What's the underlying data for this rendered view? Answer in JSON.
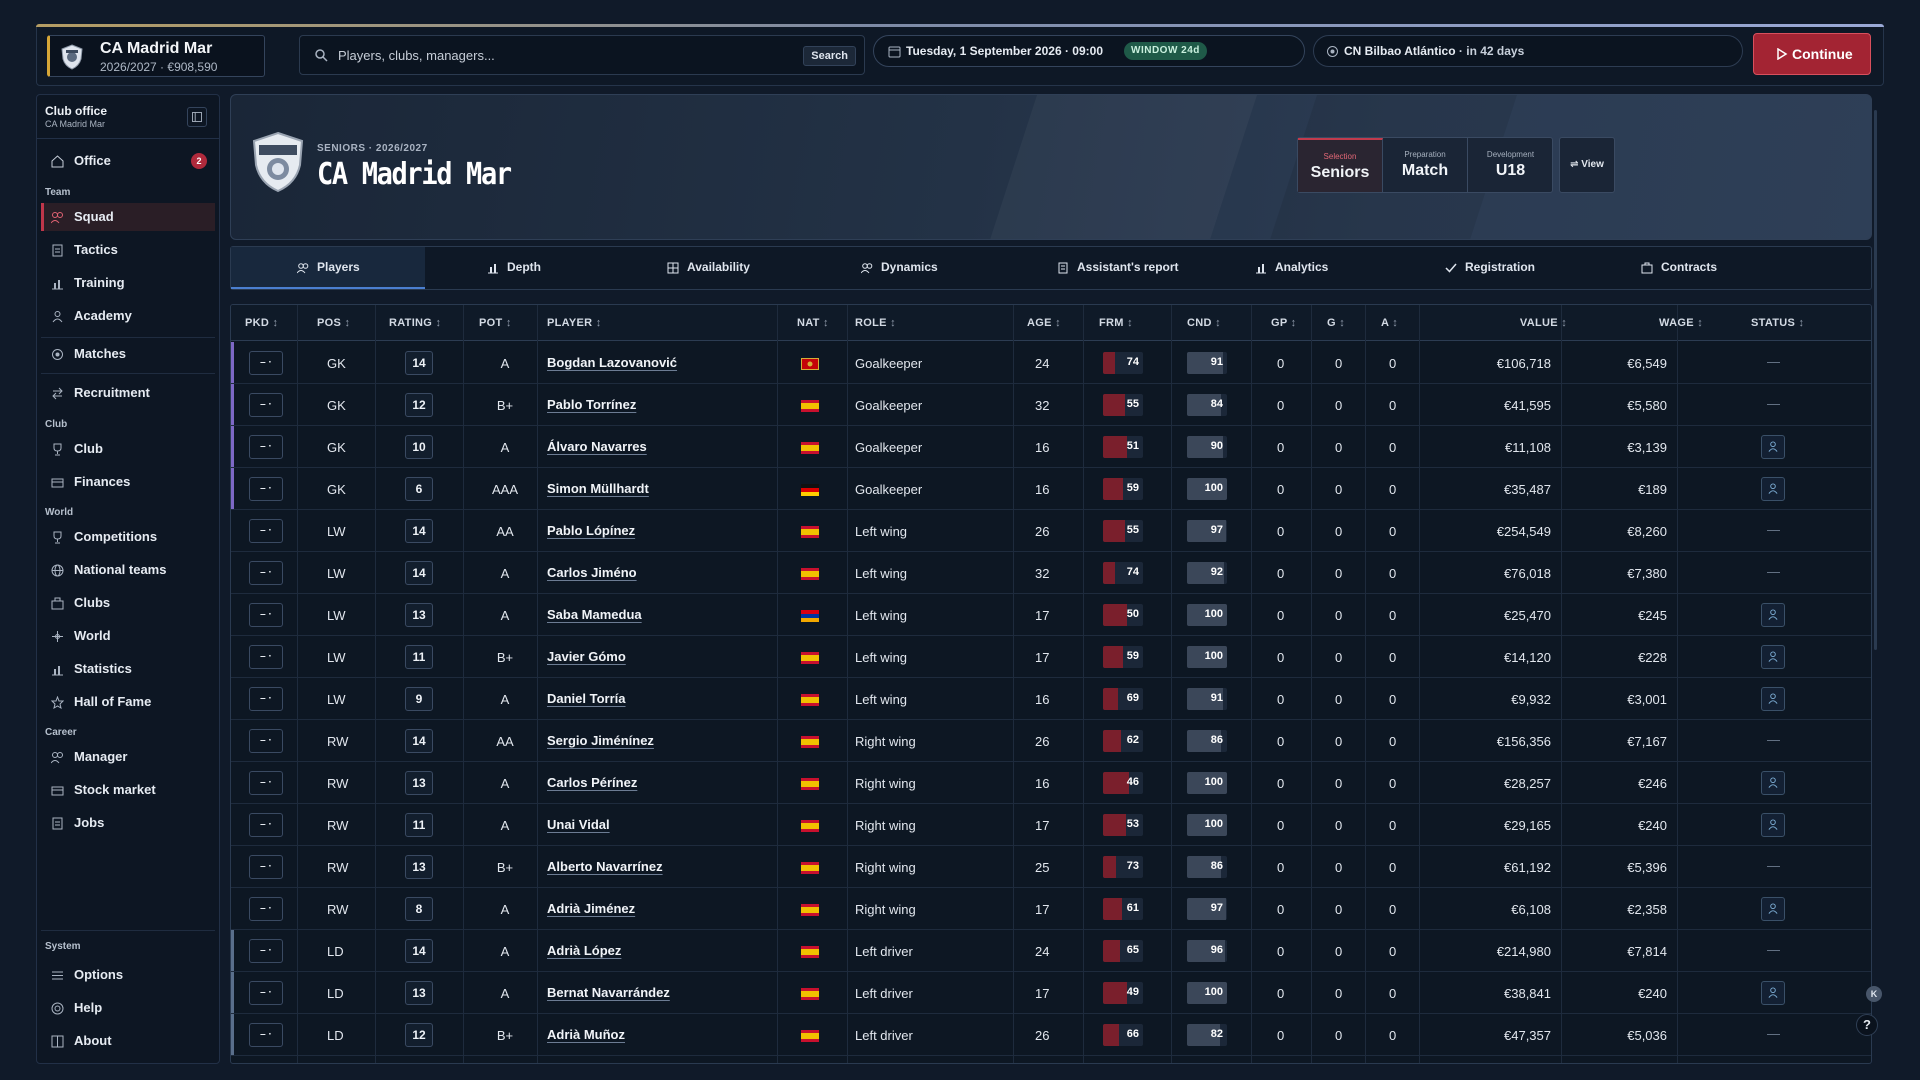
{
  "brand": {
    "name": "CA Madrid Mar",
    "season_budget": "2026/2027 · €908,590"
  },
  "search": {
    "placeholder": "Players, clubs, managers...",
    "button": "Search"
  },
  "date": {
    "text": "Tuesday, 1 September 2026 · 09:00",
    "window": "WINDOW 24d"
  },
  "next_match": {
    "opponent": "CN Bilbao Atlántico",
    "days": "· in 42 days"
  },
  "continue_label": "Continue",
  "sidebar": {
    "title": "Club office",
    "subtitle": "CA Madrid Mar",
    "office": {
      "label": "Office",
      "badge": "2"
    },
    "team_label": "Team",
    "team_items": [
      "Squad",
      "Tactics",
      "Training",
      "Academy"
    ],
    "matches": "Matches",
    "recruitment": "Recruitment",
    "club_label": "Club",
    "club_items": [
      "Club",
      "Finances"
    ],
    "world_label": "World",
    "world_items": [
      "Competitions",
      "National teams",
      "Clubs",
      "World",
      "Statistics",
      "Hall of Fame"
    ],
    "career_label": "Career",
    "career_items": [
      "Manager",
      "Stock market",
      "Jobs"
    ],
    "system_label": "System",
    "system_items": [
      "Options",
      "Help",
      "About"
    ]
  },
  "hero": {
    "kicker": "SENIORS · 2026/2027",
    "club": "CA Madrid Mar",
    "segments": [
      {
        "key": "Selection",
        "value": "Seniors"
      },
      {
        "key": "Preparation",
        "value": "Match"
      },
      {
        "key": "Development",
        "value": "U18"
      }
    ],
    "view_label": "View"
  },
  "tabs": [
    "Players",
    "Depth",
    "Availability",
    "Dynamics",
    "Assistant's report",
    "Analytics",
    "Registration",
    "Contracts"
  ],
  "table": {
    "headers": [
      "PKD",
      "POS",
      "RATING",
      "POT",
      "PLAYER",
      "NAT",
      "ROLE",
      "AGE",
      "FRM",
      "CND",
      "GP",
      "G",
      "A",
      "VALUE",
      "WAGE",
      "STATUS"
    ],
    "pkd_placeholder": "– ·",
    "rows": [
      {
        "pos": "GK",
        "rating": "14",
        "pot": "A",
        "player": "Bogdan Lazovanović",
        "nat": "ME",
        "role": "Goalkeeper",
        "age": "24",
        "frm": "74",
        "cnd": "91",
        "gp": "0",
        "g": "0",
        "a": "0",
        "value": "€106,718",
        "wage": "€6,549",
        "status": "—"
      },
      {
        "pos": "GK",
        "rating": "12",
        "pot": "B+",
        "player": "Pablo Torrínez",
        "nat": "ES",
        "role": "Goalkeeper",
        "age": "32",
        "frm": "55",
        "cnd": "84",
        "gp": "0",
        "g": "0",
        "a": "0",
        "value": "€41,595",
        "wage": "€5,580",
        "status": "—"
      },
      {
        "pos": "GK",
        "rating": "10",
        "pot": "A",
        "player": "Álvaro Navarres",
        "nat": "ES",
        "role": "Goalkeeper",
        "age": "16",
        "frm": "51",
        "cnd": "90",
        "gp": "0",
        "g": "0",
        "a": "0",
        "value": "€11,108",
        "wage": "€3,139",
        "status": "youth"
      },
      {
        "pos": "GK",
        "rating": "6",
        "pot": "AAA",
        "player": "Simon Müllhardt",
        "nat": "DE",
        "role": "Goalkeeper",
        "age": "16",
        "frm": "59",
        "cnd": "100",
        "gp": "0",
        "g": "0",
        "a": "0",
        "value": "€35,487",
        "wage": "€189",
        "status": "youth"
      },
      {
        "pos": "LW",
        "rating": "14",
        "pot": "AA",
        "player": "Pablo Lópínez",
        "nat": "ES",
        "role": "Left wing",
        "age": "26",
        "frm": "55",
        "cnd": "97",
        "gp": "0",
        "g": "0",
        "a": "0",
        "value": "€254,549",
        "wage": "€8,260",
        "status": "—"
      },
      {
        "pos": "LW",
        "rating": "14",
        "pot": "A",
        "player": "Carlos Jiméno",
        "nat": "ES",
        "role": "Left wing",
        "age": "32",
        "frm": "74",
        "cnd": "92",
        "gp": "0",
        "g": "0",
        "a": "0",
        "value": "€76,018",
        "wage": "€7,380",
        "status": "—"
      },
      {
        "pos": "LW",
        "rating": "13",
        "pot": "A",
        "player": "Saba Mamedua",
        "nat": "AM",
        "role": "Left wing",
        "age": "17",
        "frm": "50",
        "cnd": "100",
        "gp": "0",
        "g": "0",
        "a": "0",
        "value": "€25,470",
        "wage": "€245",
        "status": "youth"
      },
      {
        "pos": "LW",
        "rating": "11",
        "pot": "B+",
        "player": "Javier Gómo",
        "nat": "ES",
        "role": "Left wing",
        "age": "17",
        "frm": "59",
        "cnd": "100",
        "gp": "0",
        "g": "0",
        "a": "0",
        "value": "€14,120",
        "wage": "€228",
        "status": "youth"
      },
      {
        "pos": "LW",
        "rating": "9",
        "pot": "A",
        "player": "Daniel Torría",
        "nat": "ES",
        "role": "Left wing",
        "age": "16",
        "frm": "69",
        "cnd": "91",
        "gp": "0",
        "g": "0",
        "a": "0",
        "value": "€9,932",
        "wage": "€3,001",
        "status": "youth"
      },
      {
        "pos": "RW",
        "rating": "14",
        "pot": "AA",
        "player": "Sergio Jiménínez",
        "nat": "ES",
        "role": "Right wing",
        "age": "26",
        "frm": "62",
        "cnd": "86",
        "gp": "0",
        "g": "0",
        "a": "0",
        "value": "€156,356",
        "wage": "€7,167",
        "status": "—"
      },
      {
        "pos": "RW",
        "rating": "13",
        "pot": "A",
        "player": "Carlos Pérínez",
        "nat": "ES",
        "role": "Right wing",
        "age": "16",
        "frm": "46",
        "cnd": "100",
        "gp": "0",
        "g": "0",
        "a": "0",
        "value": "€28,257",
        "wage": "€246",
        "status": "youth"
      },
      {
        "pos": "RW",
        "rating": "11",
        "pot": "A",
        "player": "Unai Vidal",
        "nat": "ES",
        "role": "Right wing",
        "age": "17",
        "frm": "53",
        "cnd": "100",
        "gp": "0",
        "g": "0",
        "a": "0",
        "value": "€29,165",
        "wage": "€240",
        "status": "youth"
      },
      {
        "pos": "RW",
        "rating": "13",
        "pot": "B+",
        "player": "Alberto Navarrínez",
        "nat": "ES",
        "role": "Right wing",
        "age": "25",
        "frm": "73",
        "cnd": "86",
        "gp": "0",
        "g": "0",
        "a": "0",
        "value": "€61,192",
        "wage": "€5,396",
        "status": "—"
      },
      {
        "pos": "RW",
        "rating": "8",
        "pot": "A",
        "player": "Adrià Jiménez",
        "nat": "ES",
        "role": "Right wing",
        "age": "17",
        "frm": "61",
        "cnd": "97",
        "gp": "0",
        "g": "0",
        "a": "0",
        "value": "€6,108",
        "wage": "€2,358",
        "status": "youth"
      },
      {
        "pos": "LD",
        "rating": "14",
        "pot": "A",
        "player": "Adrià López",
        "nat": "ES",
        "role": "Left driver",
        "age": "24",
        "frm": "65",
        "cnd": "96",
        "gp": "0",
        "g": "0",
        "a": "0",
        "value": "€214,980",
        "wage": "€7,814",
        "status": "—"
      },
      {
        "pos": "LD",
        "rating": "13",
        "pot": "A",
        "player": "Bernat Navarrández",
        "nat": "ES",
        "role": "Left driver",
        "age": "17",
        "frm": "49",
        "cnd": "100",
        "gp": "0",
        "g": "0",
        "a": "0",
        "value": "€38,841",
        "wage": "€240",
        "status": "youth"
      },
      {
        "pos": "LD",
        "rating": "12",
        "pot": "B+",
        "player": "Adrià Muñoz",
        "nat": "ES",
        "role": "Left driver",
        "age": "26",
        "frm": "66",
        "cnd": "82",
        "gp": "0",
        "g": "0",
        "a": "0",
        "value": "€47,357",
        "wage": "€5,036",
        "status": "—"
      }
    ]
  },
  "colors": {
    "accent": "#c0364a",
    "frm_red": "#7a1f2c",
    "cnd_grey": "#3b4759",
    "youth_icon": "#7fb0d8"
  },
  "help_label": "?",
  "kb_label": "K"
}
